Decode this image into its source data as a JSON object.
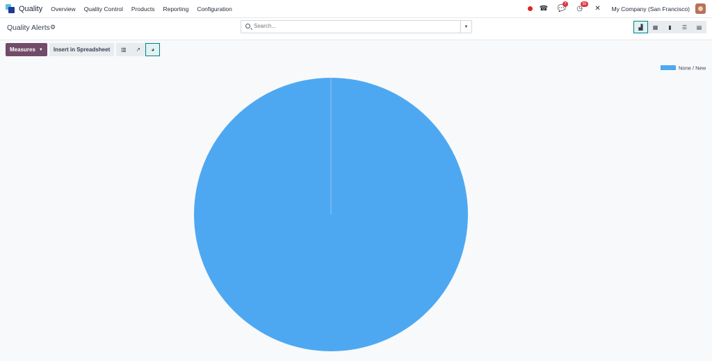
{
  "navbar": {
    "app_name": "Quality",
    "menu": [
      "Overview",
      "Quality Control",
      "Products",
      "Reporting",
      "Configuration"
    ],
    "messages_badge": "7",
    "activities_badge": "56",
    "company": "My Company (San Francisco)"
  },
  "control": {
    "title": "Quality Alerts",
    "search_placeholder": "Search..."
  },
  "toolbar": {
    "measures_label": "Measures",
    "insert_label": "Insert in Spreadsheet"
  },
  "icons": {
    "phone": "phone-icon",
    "chat": "chat-icon",
    "clock": "clock-icon",
    "tools": "tools-icon"
  },
  "chart_data": {
    "type": "pie",
    "categories": [
      "None / New"
    ],
    "values": [
      100
    ],
    "colors": [
      "#4ea8f1"
    ],
    "legend_position": "top-right"
  }
}
